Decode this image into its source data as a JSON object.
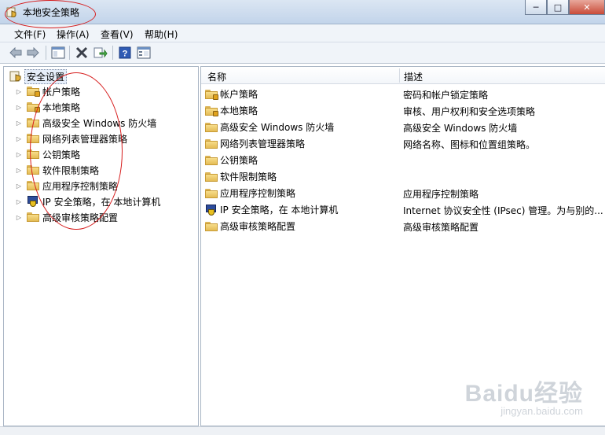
{
  "window": {
    "title": "本地安全策略",
    "controls": {
      "minimize": "─",
      "maximize": "□",
      "close": "✕"
    }
  },
  "menu": [
    "文件(F)",
    "操作(A)",
    "查看(V)",
    "帮助(H)"
  ],
  "toolbar": {
    "buttons": [
      "back-arrow-icon",
      "forward-arrow-icon",
      "show-hide-console-tree-icon",
      "delete-x-icon",
      "export-list-icon",
      "help-icon",
      "properties-icon"
    ]
  },
  "tree": {
    "root": "安全设置",
    "items": [
      {
        "label": "帐户策略",
        "icon": "folder-lock-icon"
      },
      {
        "label": "本地策略",
        "icon": "folder-lock-icon"
      },
      {
        "label": "高级安全 Windows 防火墙",
        "icon": "folder-icon"
      },
      {
        "label": "网络列表管理器策略",
        "icon": "folder-icon"
      },
      {
        "label": "公钥策略",
        "icon": "folder-icon"
      },
      {
        "label": "软件限制策略",
        "icon": "folder-icon"
      },
      {
        "label": "应用程序控制策略",
        "icon": "folder-icon"
      },
      {
        "label": "IP 安全策略，在 本地计算机",
        "icon": "ip-security-icon"
      },
      {
        "label": "高级审核策略配置",
        "icon": "folder-icon"
      }
    ]
  },
  "list": {
    "columns": [
      "名称",
      "描述"
    ],
    "rows": [
      {
        "name": "帐户策略",
        "desc": "密码和帐户锁定策略"
      },
      {
        "name": "本地策略",
        "desc": "审核、用户权利和安全选项策略"
      },
      {
        "name": "高级安全 Windows 防火墙",
        "desc": "高级安全 Windows 防火墙"
      },
      {
        "name": "网络列表管理器策略",
        "desc": "网络名称、图标和位置组策略。"
      },
      {
        "name": "公钥策略",
        "desc": ""
      },
      {
        "name": "软件限制策略",
        "desc": ""
      },
      {
        "name": "应用程序控制策略",
        "desc": "应用程序控制策略"
      },
      {
        "name": "IP 安全策略，在 本地计算机",
        "desc": "Internet 协议安全性 (IPsec) 管理。为与别的..."
      },
      {
        "name": "高级审核策略配置",
        "desc": "高级审核策略配置"
      }
    ]
  },
  "watermark": {
    "brand": "Baidu经验",
    "url": "jingyan.baidu.com"
  },
  "colors": {
    "annotation": "#d61c1c",
    "title_bar": "#c2d4ea"
  }
}
